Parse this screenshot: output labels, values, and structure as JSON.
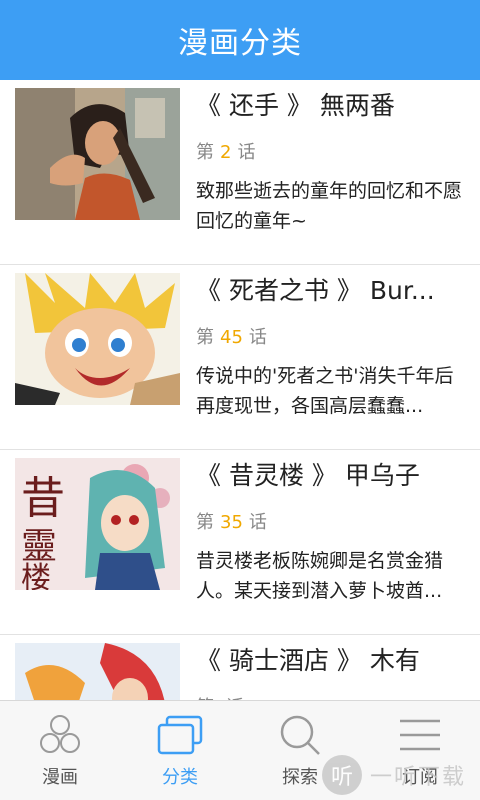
{
  "header": {
    "title": "漫画分类"
  },
  "items": [
    {
      "title": "《 还手 》 無两番",
      "ep_prefix": "第",
      "ep_num": "2",
      "ep_suffix": "话",
      "desc": "致那些逝去的童年的回忆和不愿回忆的童年~"
    },
    {
      "title": "《 死者之书 》 Bur...",
      "ep_prefix": "第",
      "ep_num": "45",
      "ep_suffix": "话",
      "desc": "传说中的'死者之书'消失千年后再度现世，各国高层蠢蠢..."
    },
    {
      "title": "《 昔灵楼 》 甲乌子",
      "ep_prefix": "第",
      "ep_num": "35",
      "ep_suffix": "话",
      "desc": "昔灵楼老板陈婉卿是名赏金猎人。某天接到潜入萝卜坡酋..."
    },
    {
      "title": "《 骑士酒店 》 木有",
      "ep_prefix": "第",
      "ep_num": "",
      "ep_suffix": "话",
      "desc": ""
    }
  ],
  "thumb_art": {
    "item3": "昔靈楼"
  },
  "tabs": [
    {
      "label": "漫画",
      "icon": "comic-icon"
    },
    {
      "label": "分类",
      "icon": "category-icon"
    },
    {
      "label": "探索",
      "icon": "search-icon"
    },
    {
      "label": "订阅",
      "icon": "subscribe-icon"
    }
  ],
  "active_tab": "分类",
  "watermark": {
    "logo": "听",
    "text": "一听下载"
  },
  "colors": {
    "accent": "#3d9ef4",
    "episode_number": "#f0a800"
  }
}
